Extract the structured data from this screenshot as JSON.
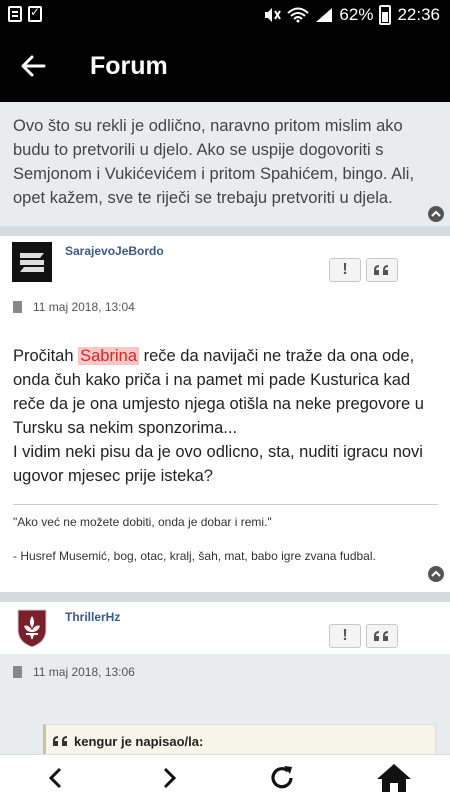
{
  "status_bar": {
    "battery": "62%",
    "time": "22:36"
  },
  "app_bar": {
    "title": "Forum"
  },
  "quoted_prev": {
    "text": "Ovo što su rekli je odlično, naravno pritom mislim ako budu to pretvorili u djelo. Ako se uspije dogovoriti s Semjonom i Vukićevićem i pritom Spahićem, bingo. Ali, opet kažem, sve te riječi se trebaju pretvoriti u djela."
  },
  "posts": [
    {
      "author": "SarajevoJeBordo",
      "date": "11 maj 2018, 13:04",
      "body_before": "Pročitah ",
      "body_highlight": "Sabrina",
      "body_after": " reče da navijači ne traže da ona ode, onda čuh kako priča i na pamet mi pade Kusturica kad reče da je ona umjesto njega otišla na neke pregovore u Tursku sa nekim sponzorima...",
      "body_line2": "I vidim neki pisu da je ovo odlicno, sta, nuditi igracu novi ugovor mjesec prije isteka?",
      "signature_quote": "\"Ako već ne možete dobiti, onda je dobar i remi.\"",
      "signature_author": "- Husref Musemić, bog, otac, kralj, šah, mat, babo igre zvana fudbal."
    },
    {
      "author": "ThrillerHz",
      "date": "11 maj 2018, 13:06",
      "quote_header": "kengur je napisao/la:"
    }
  ],
  "actions": {
    "report": "!",
    "quote": "❝❝"
  },
  "colors": {
    "app_bar": "#000000",
    "quote_bg": "#e9ecef",
    "author": "#3a5a88",
    "highlight_bg": "#f9c6c6",
    "highlight_text": "#cc2a2a"
  },
  "icons": {
    "back": "arrow-left-icon",
    "prev": "chevron-left-icon",
    "next": "chevron-right-icon",
    "refresh": "refresh-icon",
    "home": "home-icon"
  }
}
